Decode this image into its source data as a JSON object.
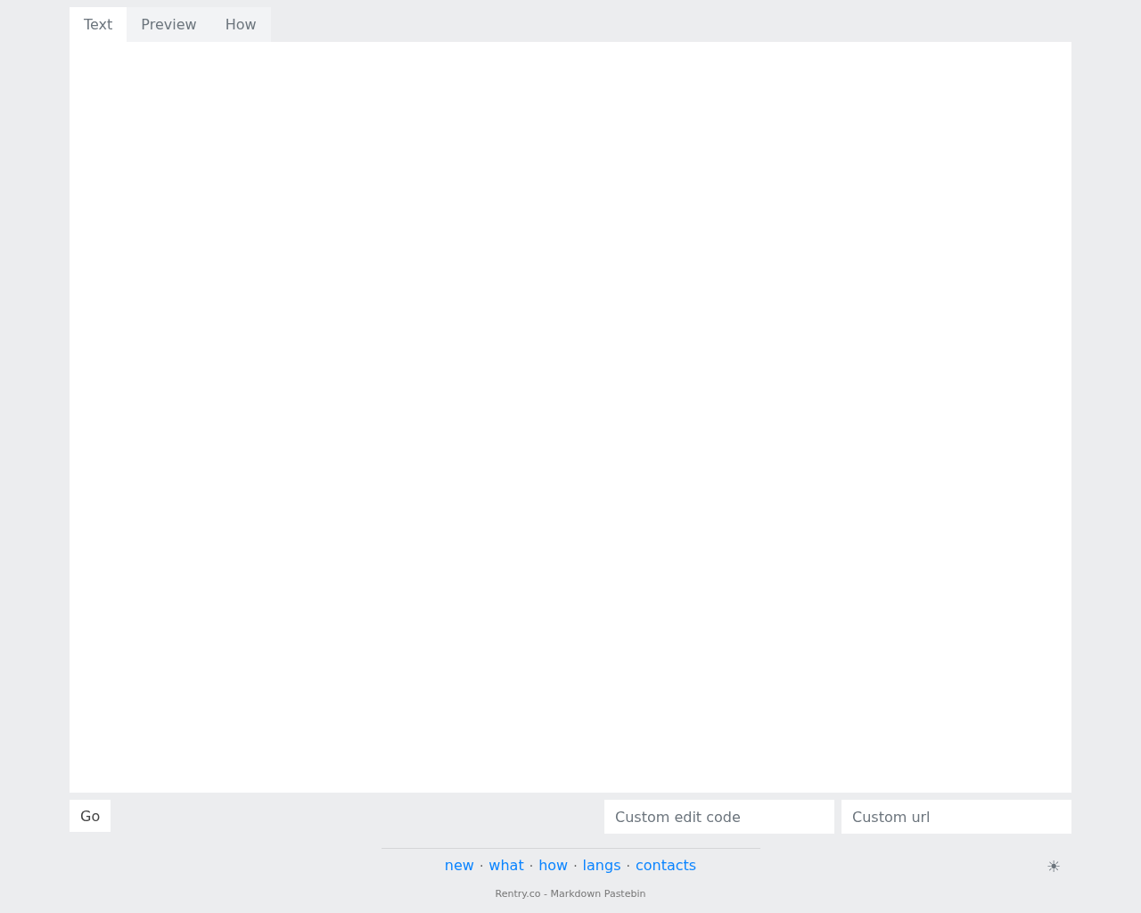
{
  "tabs": [
    {
      "label": "Text",
      "selected": true
    },
    {
      "label": "Preview",
      "selected": false
    },
    {
      "label": "How",
      "selected": false
    }
  ],
  "go_button": "Go",
  "fields": [
    {
      "placeholder": "Custom edit code"
    },
    {
      "placeholder": "Custom url"
    }
  ],
  "links": [
    "new",
    "what",
    "how",
    "langs",
    "contacts"
  ],
  "separator": "·",
  "theme_toggle": "☀",
  "footer": "Rentry.co - Markdown Pastebin"
}
